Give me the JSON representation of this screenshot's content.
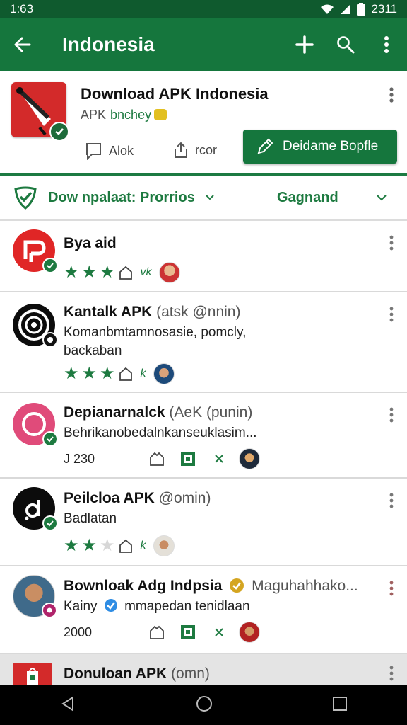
{
  "status_bar": {
    "time": "1:63",
    "battery": "2311"
  },
  "app_bar": {
    "title": "Indonesia"
  },
  "header_card": {
    "title": "Download APK Indonesia",
    "subtitle": "APK",
    "subtitle_accent": "bnchey",
    "action_1_label": "Alok",
    "action_2_label": "rcor",
    "primary_button_label": "Deidame Bopfle"
  },
  "filter_bar": {
    "left_label": "Dow npalaat: Prorrios",
    "right_label": "Gagnand"
  },
  "rows": [
    {
      "title": "Bya aid",
      "rating": 3,
      "meta": "vk"
    },
    {
      "title": "Kantalk APK",
      "title_suffix": "(atsk @nnin)",
      "desc_1": "Komanbmtamnosasie, pomcly,",
      "desc_2": "backaban",
      "rating": 3,
      "meta": "k"
    },
    {
      "title": "Depianarnalck",
      "title_suffix": "(AeK (punin)",
      "desc_1": "Behrikanobedalnkanseuklasim...",
      "count": "J 230"
    },
    {
      "title": "Peilcloa APK",
      "title_suffix": "@omin)",
      "desc_1": "Badlatan",
      "rating": 2,
      "meta": "k"
    },
    {
      "title": "Bownloak Adg Indpsia",
      "title_suffix": "Maguhahhako...",
      "desc_1": "Kainy",
      "desc_1_suffix": "mmapedan tenidlaan",
      "count": "2000"
    },
    {
      "title": "Donuloan APK",
      "title_suffix": "(omn)"
    }
  ],
  "colors": {
    "primary": "#15763d",
    "primary_dark": "#0f5a2e",
    "accent_text": "#1d7a40"
  },
  "icons": [
    "back-arrow-icon",
    "add-icon",
    "search-icon",
    "more-vert-icon",
    "chat-icon",
    "share-icon",
    "edit-pencil-icon",
    "shield-check-icon",
    "chevron-down-icon",
    "verified-badge-icon",
    "star-icon",
    "home-outline-icon",
    "qr-square-icon",
    "close-x-icon",
    "nav-back-icon",
    "nav-home-icon",
    "nav-recents-icon"
  ]
}
